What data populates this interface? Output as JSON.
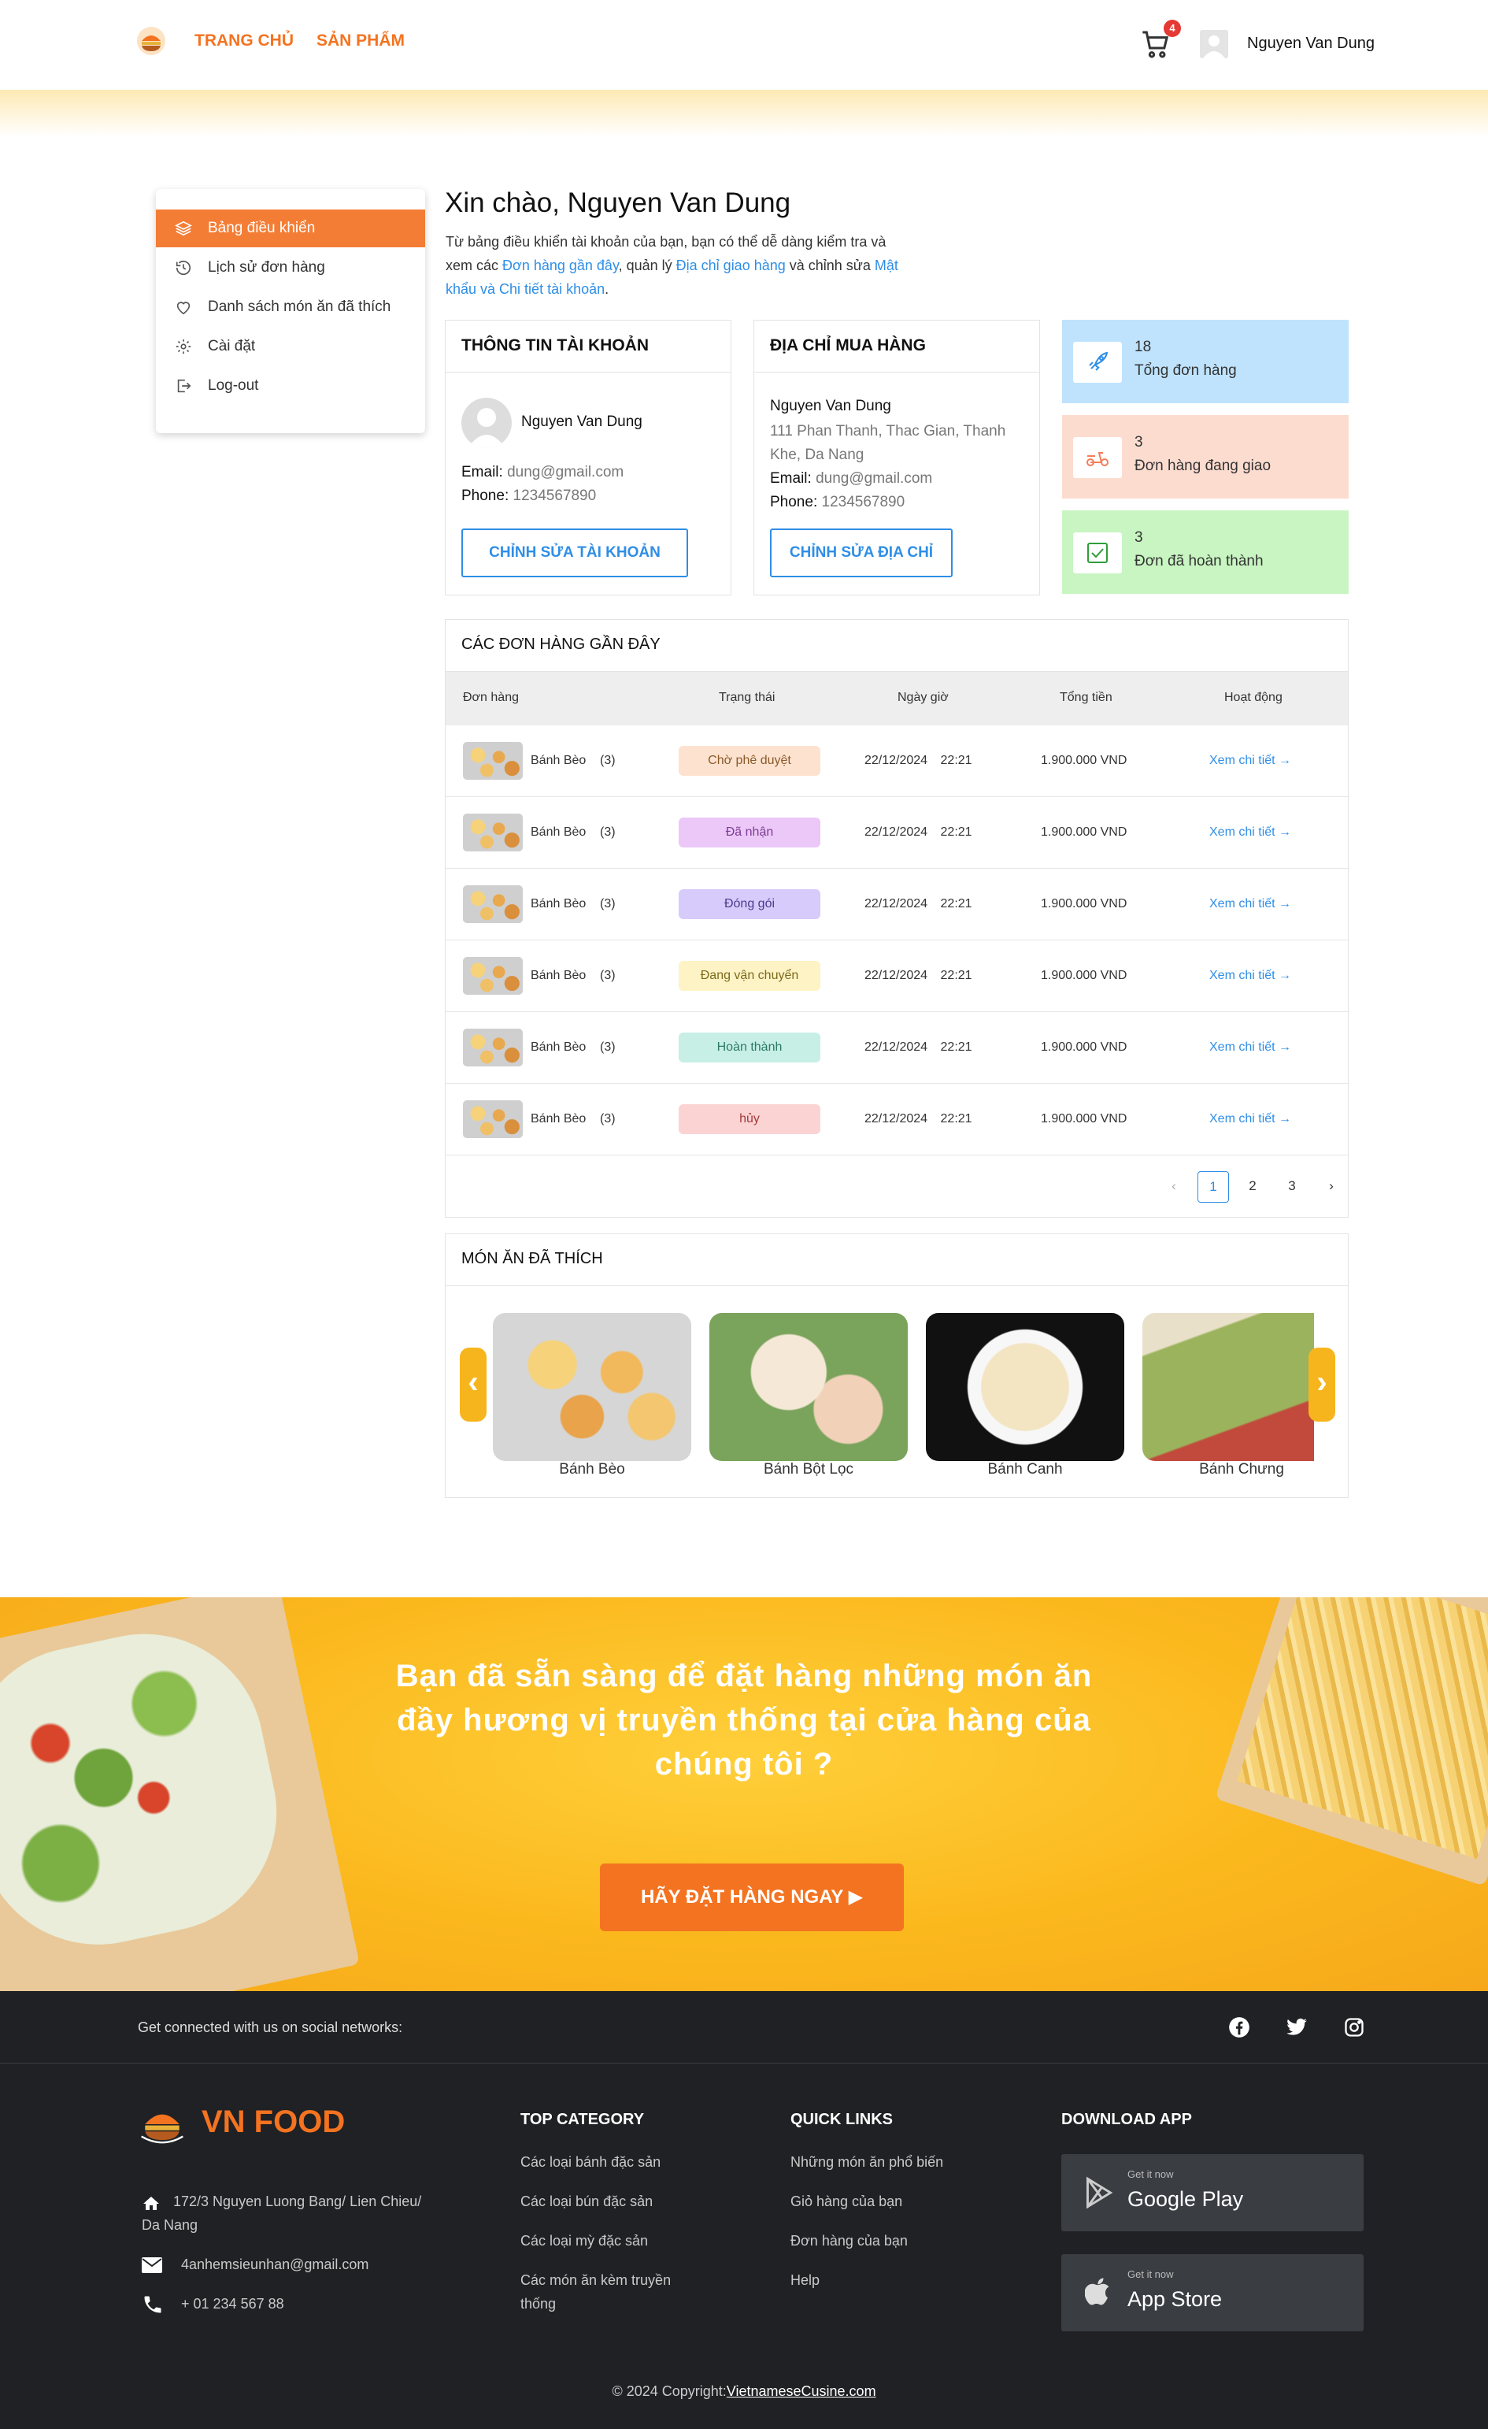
{
  "header": {
    "nav": [
      "TRANG CHỦ",
      "SẢN PHẨM"
    ],
    "cart_count": "4",
    "user_name": "Nguyen Van Dung"
  },
  "sidebar": {
    "items": [
      {
        "label": "Bảng điều khiển",
        "icon": "layers-icon",
        "active": true
      },
      {
        "label": "Lịch sử đơn hàng",
        "icon": "history-icon"
      },
      {
        "label": "Danh sách món ăn đã thích",
        "icon": "heart-icon"
      },
      {
        "label": "Cài đặt",
        "icon": "gear-icon"
      },
      {
        "label": "Log-out",
        "icon": "logout-icon"
      }
    ]
  },
  "intro": {
    "greeting": "Xin chào, Nguyen Van Dung",
    "text_1": "Từ bảng điều khiển tài khoản của bạn, bạn có thể dễ dàng kiểm tra và xem các ",
    "link_orders": "Đơn hàng gần đây",
    "text_2": ", quản lý ",
    "link_address": "Địa chỉ giao hàng",
    "text_3": " và chỉnh sửa ",
    "link_password": "Mật khẩu và Chi tiết tài khoản",
    "text_4": "."
  },
  "account": {
    "title": "THÔNG TIN TÀI KHOẢN",
    "name": "Nguyen Van Dung",
    "email_label": "Email:",
    "email": "dung@gmail.com",
    "phone_label": "Phone:",
    "phone": "1234567890",
    "button": "CHỈNH SỬA TÀI KHOẢN"
  },
  "address": {
    "title": "ĐỊA CHỈ MUA HÀNG",
    "name": "Nguyen Van Dung",
    "line": "111 Phan Thanh, Thac Gian, Thanh Khe, Da Nang",
    "email_label": "Email:",
    "email": "dung@gmail.com",
    "phone_label": "Phone:",
    "phone": "1234567890",
    "button": "CHỈNH SỬA ĐỊA CHỈ"
  },
  "stats": [
    {
      "value": "18",
      "label": "Tổng đơn hàng",
      "icon": "rocket-icon",
      "bg": "#bfe3fd",
      "color": "#2f8ee6"
    },
    {
      "value": "3",
      "label": "Đơn hàng đang giao",
      "icon": "scooter-icon",
      "bg": "#fddcd0",
      "color": "#f47d5a"
    },
    {
      "value": "3",
      "label": "Đơn đã hoàn thành",
      "icon": "check-square-icon",
      "bg": "#c8f5c1",
      "color": "#2e9e3a"
    }
  ],
  "orders": {
    "title": "CÁC ĐƠN HÀNG GẦN ĐÂY",
    "columns": [
      "Đơn hàng",
      "Trạng thái",
      "Ngày giờ",
      "Tổng tiền",
      "Hoạt động"
    ],
    "rows": [
      {
        "name": "Bánh Bèo",
        "qty": "(3)",
        "status": "Chờ phê duyệt",
        "status_bg": "#fde3cf",
        "status_fg": "#8a5a2b",
        "datetime": "22/12/2024 22:21",
        "total": "1.900.000 VND",
        "action": "Xem chi tiết"
      },
      {
        "name": "Bánh Bèo",
        "qty": "(3)",
        "status": "Đã nhận",
        "status_bg": "#ecc8f8",
        "status_fg": "#7a3d93",
        "datetime": "22/12/2024 22:21",
        "total": "1.900.000 VND",
        "action": "Xem chi tiết"
      },
      {
        "name": "Bánh Bèo",
        "qty": "(3)",
        "status": "Đóng gói",
        "status_bg": "#d7cbfb",
        "status_fg": "#4b3a8e",
        "datetime": "22/12/2024 22:21",
        "total": "1.900.000 VND",
        "action": "Xem chi tiết"
      },
      {
        "name": "Bánh Bèo",
        "qty": "(3)",
        "status": "Đang vận chuyển",
        "status_bg": "#fdf3c4",
        "status_fg": "#7d6a1d",
        "datetime": "22/12/2024 22:21",
        "total": "1.900.000 VND",
        "action": "Xem chi tiết"
      },
      {
        "name": "Bánh Bèo",
        "qty": "(3)",
        "status": "Hoàn thành",
        "status_bg": "#c7efe6",
        "status_fg": "#2d7a66",
        "datetime": "22/12/2024 22:21",
        "total": "1.900.000 VND",
        "action": "Xem chi tiết"
      },
      {
        "name": "Bánh Bèo",
        "qty": "(3)",
        "status": "hủy",
        "status_bg": "#fbd3d3",
        "status_fg": "#a23a3a",
        "datetime": "22/12/2024 22:21",
        "total": "1.900.000 VND",
        "action": "Xem chi tiết"
      }
    ],
    "pagination": {
      "prev": "‹",
      "pages": [
        "1",
        "2",
        "3"
      ],
      "current": "1",
      "next": "›"
    }
  },
  "favorites": {
    "title": "MÓN ĂN ĐÃ THÍCH",
    "items": [
      "Bánh Bèo",
      "Bánh Bột Lọc",
      "Bánh Canh",
      "Bánh Chưng"
    ]
  },
  "banner": {
    "text": "Bạn đã sẵn sàng để đặt hàng những món ăn đầy hương vị truyền thống tại cửa hàng của chúng tôi ?",
    "button": "HÃY ĐẶT HÀNG NGAY ▶"
  },
  "social": {
    "text": "Get connected with us on social networks:",
    "icons": [
      "facebook-icon",
      "twitter-icon",
      "instagram-icon"
    ]
  },
  "footer": {
    "brand": "VN FOOD",
    "address": "172/3 Nguyen Luong Bang/ Lien Chieu/ Da Nang",
    "email": "4anhemsieunhan@gmail.com",
    "phone": "+ 01 234 567 88",
    "col1_title": "TOP CATEGORY",
    "col1_links": [
      "Các loại bánh đặc sản",
      "Các loại bún đặc sản",
      "Các loại mỳ đặc sản",
      "Các món ăn kèm truyền thống"
    ],
    "col2_title": "QUICK LINKS",
    "col2_links": [
      "Những món ăn phổ biến",
      "Giỏ hàng của bạn",
      "Đơn hàng của bạn",
      "Help"
    ],
    "col3_title": "DOWNLOAD APP",
    "google_small": "Get it now",
    "google_big": "Google Play",
    "apple_small": "Get it now",
    "apple_big": "App Store",
    "copyright": "© 2024 Copyright:",
    "copyright_link": "VietnameseCusine.com"
  }
}
